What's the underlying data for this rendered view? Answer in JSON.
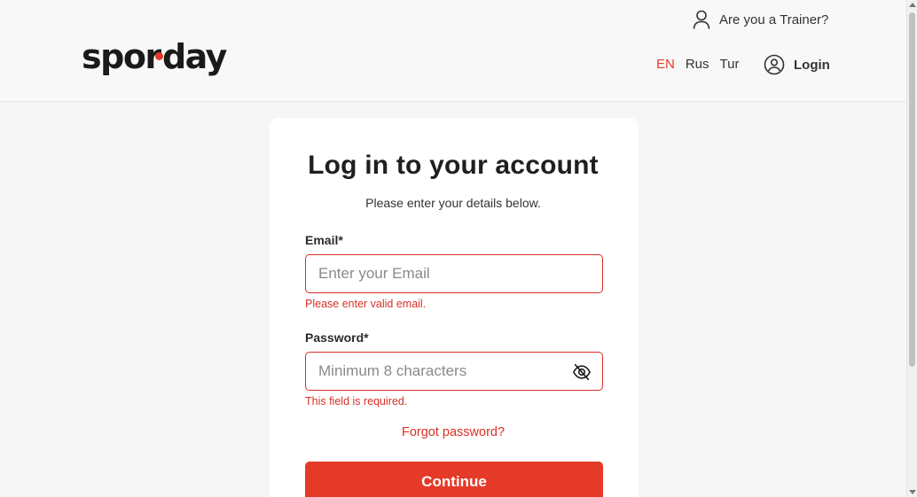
{
  "header": {
    "logo_text": "spor day",
    "trainer_link": "Are you a Trainer?",
    "languages": [
      "EN",
      "Rus",
      "Tur"
    ],
    "active_language": "EN",
    "login_label": "Login"
  },
  "form": {
    "title": "Log in to your account",
    "subtitle": "Please enter your details below.",
    "email_label": "Email*",
    "email_placeholder": "Enter your Email",
    "email_value": "",
    "email_error": "Please enter valid email.",
    "password_label": "Password*",
    "password_placeholder": "Minimum 8 characters",
    "password_value": "",
    "password_error": "This field is required.",
    "forgot_label": "Forgot password?",
    "continue_label": "Continue"
  },
  "colors": {
    "accent": "#e53a28",
    "error": "#d93025"
  },
  "icons": {
    "trainer": "user-outline-icon",
    "login": "user-circle-icon",
    "password_toggle": "eye-off-icon"
  }
}
